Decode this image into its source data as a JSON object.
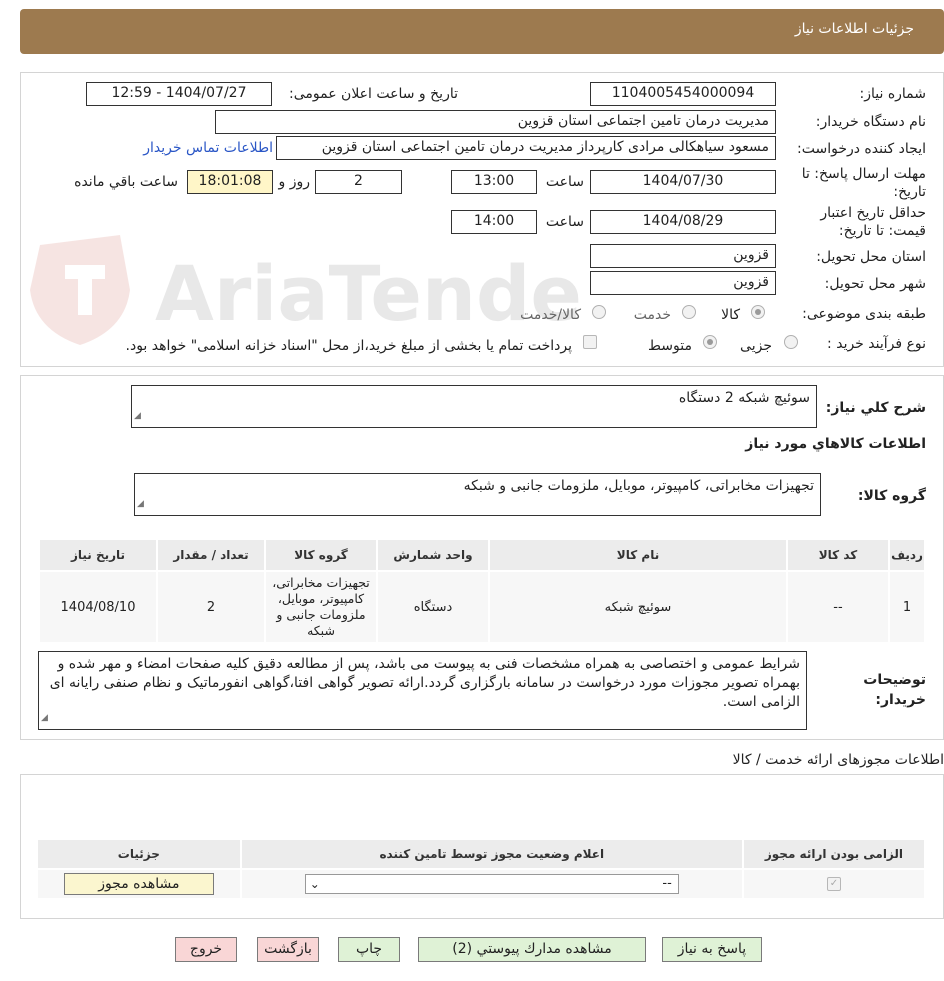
{
  "header": {
    "title": "جزئیات اطلاعات نیاز"
  },
  "watermark": {
    "text": "AriaTender.neT"
  },
  "form": {
    "need_number_label": "شماره نیاز:",
    "need_number": "1104005454000094",
    "announce_label": "تاریخ و ساعت اعلان عمومی:",
    "announce_value": "1404/07/27 - 12:59",
    "buyer_org_label": "نام دستگاه خریدار:",
    "buyer_org": "مدیریت درمان تامین اجتماعی استان قزوین",
    "requester_label": "ایجاد کننده درخواست:",
    "requester": "مسعود سیاهکالی مرادی کارپرداز مدیریت درمان تامین اجتماعی استان قزوین",
    "contact_link": "اطلاعات تماس خریدار",
    "deadline_label_1": "مهلت ارسال پاسخ: تا",
    "deadline_label_2": "تاریخ:",
    "deadline_date": "1404/07/30",
    "time_label": "ساعت",
    "deadline_time": "13:00",
    "days_value": "2",
    "days_label": "روز و",
    "remaining_time": "18:01:08",
    "remaining_label": "ساعت باقي مانده",
    "validity_label_1": "حداقل تاریخ اعتبار",
    "validity_label_2": "قیمت: تا تاریخ:",
    "validity_date": "1404/08/29",
    "validity_time_label": "ساعت",
    "validity_time": "14:00",
    "province_label": "استان محل تحویل:",
    "province": "قزوین",
    "city_label": "شهر محل تحویل:",
    "city": "قزوین",
    "category_label": "طبقه بندی موضوعی:",
    "category_options": [
      "کالا",
      "خدمت",
      "کالا/خدمت"
    ],
    "process_label": "نوع فرآیند خرید :",
    "process_options": [
      "جزیی",
      "متوسط"
    ],
    "payment_note": "پرداخت تمام یا بخشی از مبلغ خرید،از محل \"اسناد خزانه اسلامی\" خواهد بود."
  },
  "summary": {
    "general_desc_label": "شرح کلي نياز:",
    "general_desc": "سوئیچ شبکه 2 دستگاه",
    "goods_info_title": "اطلاعات کالاهاي مورد نياز",
    "goods_group_label": "گروه کالا:",
    "goods_group": "تجهیزات مخابراتی، کامپیوتر، موبایل، ملزومات جانبی و شبکه",
    "table": {
      "headers": [
        "رديف",
        "کد کالا",
        "نام کالا",
        "واحد شمارش",
        "گروه کالا",
        "تعداد / مقدار",
        "تاریخ نیاز"
      ],
      "rows": [
        {
          "row": "1",
          "code": "--",
          "name": "سوئیچ شبکه",
          "unit": "دستگاه",
          "group": "تجهیزات مخابراتی، کامپیوتر، موبایل، ملزومات جانبی و شبکه",
          "qty": "2",
          "date": "1404/08/10"
        }
      ]
    },
    "buyer_notes_label_1": "توضیحات",
    "buyer_notes_label_2": "خریدار:",
    "buyer_notes": "شرایط عمومی و اختصاصی به همراه مشخصات فنی به پیوست می باشد، پس از مطالعه دقیق کلیه صفحات امضاء و مهر شده و بهمراه تصویر مجوزات مورد درخواست در سامانه بارگزاری گردد.ارائه تصویر گواهی افتا،گواهی انفورماتیک و نظام صنفی رایانه ای الزامی است."
  },
  "permits": {
    "title": "اطلاعات مجوزهای ارائه خدمت / کالا",
    "headers": [
      "الزامی بودن ارائه مجوز",
      "اعلام وضعیت مجوز توسط تامین کننده",
      "جزئیات"
    ],
    "select_value": "--",
    "view_button": "مشاهده مجوز"
  },
  "actions": {
    "reply": "پاسخ به نیاز",
    "attachments": "مشاهده مدارك پيوستي (2)",
    "print": "چاپ",
    "back": "بازگشت",
    "exit": "خروج"
  }
}
